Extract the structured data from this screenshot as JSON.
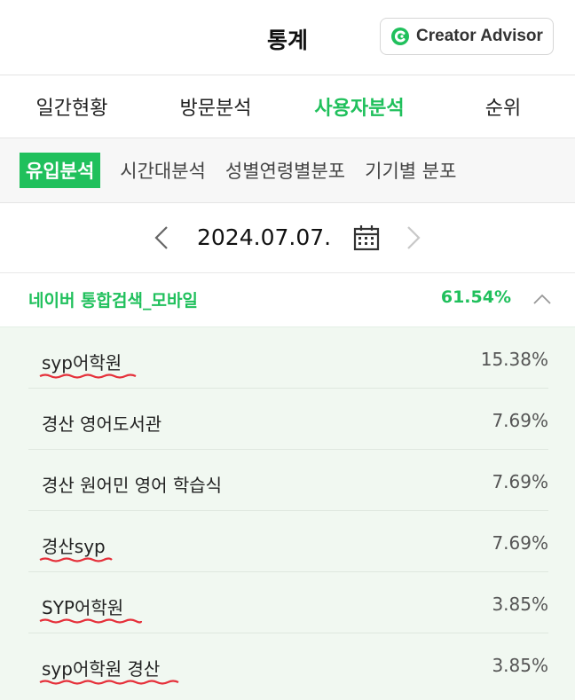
{
  "header": {
    "title": "통계",
    "creator_advisor": "Creator Advisor"
  },
  "main_tabs": [
    {
      "label": "일간현황",
      "active": false
    },
    {
      "label": "방문분석",
      "active": false
    },
    {
      "label": "사용자분석",
      "active": true
    },
    {
      "label": "순위",
      "active": false
    }
  ],
  "sub_tabs": [
    {
      "label": "유입분석",
      "active": true
    },
    {
      "label": "시간대분석",
      "active": false
    },
    {
      "label": "성별연령별분포",
      "active": false
    },
    {
      "label": "기기별 분포",
      "active": false
    }
  ],
  "date_nav": {
    "date": "2024.07.07."
  },
  "section": {
    "title": "네이버 통합검색_모바일",
    "percent": "61.54%"
  },
  "rows": [
    {
      "label": "syp어학원",
      "percent": "15.38%",
      "underlined": true
    },
    {
      "label": "경산 영어도서관",
      "percent": "7.69%",
      "underlined": false
    },
    {
      "label": "경산 원어민 영어 학습식",
      "percent": "7.69%",
      "underlined": false
    },
    {
      "label": "경산syp",
      "percent": "7.69%",
      "underlined": true
    },
    {
      "label": "SYP어학원",
      "percent": "3.85%",
      "underlined": true
    },
    {
      "label": "syp어학원 경산",
      "percent": "3.85%",
      "underlined": true
    }
  ],
  "colors": {
    "accent_green": "#20c05c",
    "list_background": "#f1f8f1",
    "annotation_red": "#e5303a"
  }
}
